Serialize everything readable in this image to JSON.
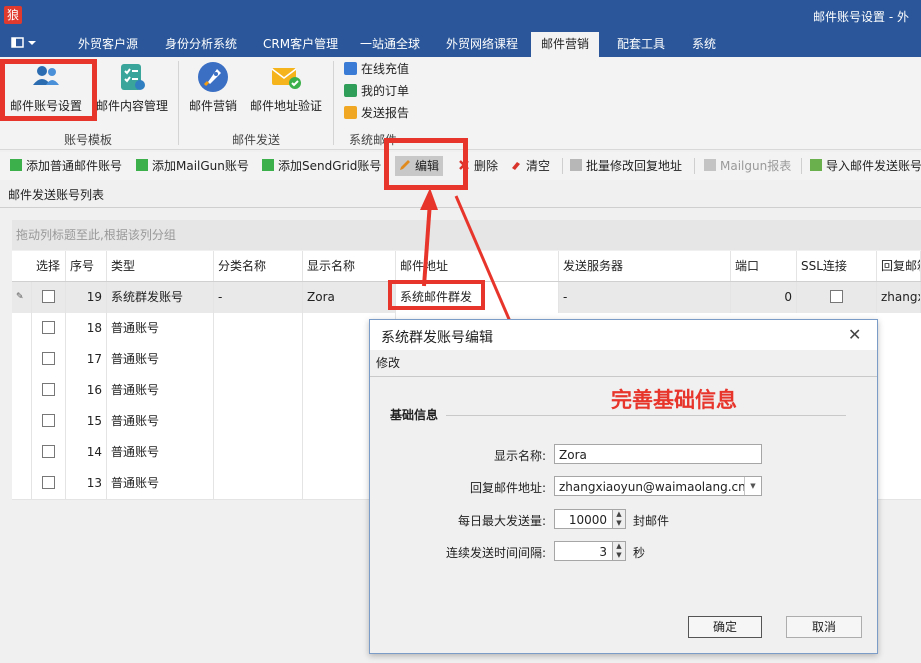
{
  "app": {
    "logo_char": "狼",
    "window_title": "邮件账号设置 - 外"
  },
  "tabs": [
    {
      "label": "外贸客户源"
    },
    {
      "label": "身份分析系统"
    },
    {
      "label": "CRM客户管理"
    },
    {
      "label": "一站通全球"
    },
    {
      "label": "外贸网络课程"
    },
    {
      "label": "邮件营销"
    },
    {
      "label": "配套工具"
    },
    {
      "label": "系统"
    }
  ],
  "ribbon": {
    "group1": {
      "label": "账号模板",
      "btn1": "邮件账号设置",
      "btn2": "邮件内容管理"
    },
    "group2": {
      "label": "邮件发送",
      "btn1": "邮件营销",
      "btn2": "邮件地址验证"
    },
    "group3": {
      "label": "系统邮件",
      "item1": "在线充值",
      "item2": "我的订单",
      "item3": "发送报告"
    }
  },
  "toolbar": {
    "add_normal": "添加普通邮件账号",
    "add_mailgun": "添加MailGun账号",
    "add_sendgrid": "添加SendGrid账号",
    "edit": "编辑",
    "delete": "删除",
    "clear": "清空",
    "batch_reply": "批量修改回复地址",
    "mailgun_report": "Mailgun报表",
    "import": "导入邮件发送账号"
  },
  "subtab": "邮件发送账号列表",
  "grid": {
    "group_hint": "拖动列标题至此,根据该列分组",
    "headers": [
      "选择",
      "序号",
      "类型",
      "分类名称",
      "显示名称",
      "邮件地址",
      "发送服务器",
      "端口",
      "SSL连接",
      "回复邮箱"
    ],
    "rows": [
      {
        "no": "19",
        "type": "系统群发账号",
        "category": "-",
        "display": "Zora",
        "email": "系统邮件群发",
        "server": "-",
        "port": "0"
      },
      {
        "no": "18",
        "type": "普通账号"
      },
      {
        "no": "17",
        "type": "普通账号"
      },
      {
        "no": "16",
        "type": "普通账号"
      },
      {
        "no": "15",
        "type": "普通账号"
      },
      {
        "no": "14",
        "type": "普通账号"
      },
      {
        "no": "13",
        "type": "普通账号"
      }
    ],
    "row1_reply": "zhangxi"
  },
  "dialog": {
    "title": "系统群发账号编辑",
    "tab": "修改",
    "section": "基础信息",
    "display_label": "显示名称:",
    "display_value": "Zora",
    "reply_label": "回复邮件地址:",
    "reply_value": "zhangxiaoyun@waimaolang.cn",
    "max_label": "每日最大发送量:",
    "max_value": "10000",
    "max_unit": "封邮件",
    "interval_label": "连续发送时间间隔:",
    "interval_value": "3",
    "interval_unit": "秒",
    "ok": "确定",
    "cancel": "取消"
  },
  "annotation": "完善基础信息",
  "colors": {
    "accent": "#2b579a",
    "highlight": "#e8352c"
  }
}
